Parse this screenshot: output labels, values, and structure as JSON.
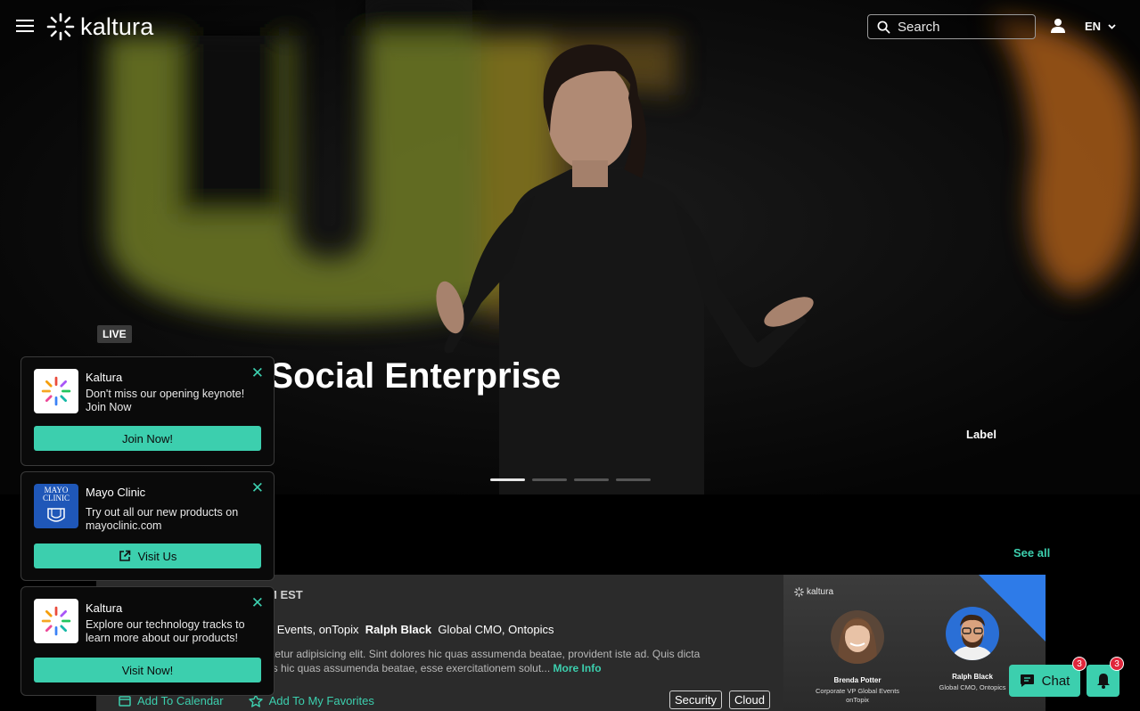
{
  "header": {
    "logo_text": "kaltura",
    "search_placeholder": "Search",
    "language": "EN"
  },
  "hero": {
    "live_badge": "LIVE",
    "title": "f Social Enterprise",
    "label": "Label",
    "slides_total": 4,
    "slide_active": 1
  },
  "session": {
    "see_all": "See all",
    "time": "M EST",
    "speakers_prefix": "al Events, onTopix",
    "speaker2_name": "Ralph Black",
    "speaker2_role": "Global CMO, Ontopics",
    "description_line1": "ctetur adipisicing elit. Sint dolores hic quas assumenda beatae, provident iste ad. Quis dicta",
    "description_line2": "es hic quas assumenda beatae, esse exercitationem solut...",
    "more_info": "More Info",
    "add_to_calendar": "Add To Calendar",
    "add_to_favorites": "Add To My Favorites",
    "tags": [
      "Security",
      "Cloud"
    ],
    "thumbnail": {
      "logo_text": "kaltura",
      "speakers": [
        {
          "name": "Brenda Potter",
          "role": "Corporate VP Global Events onTopix"
        },
        {
          "name": "Ralph Black",
          "role": "Global CMO, Ontopics"
        }
      ]
    }
  },
  "notifications": [
    {
      "brand": "Kaltura",
      "message": "Don't miss our opening keynote! Join Now",
      "cta": "Join Now!"
    },
    {
      "brand": "Mayo Clinic",
      "message": "Try out all our new products on mayoclinic.com",
      "cta": "Visit Us",
      "logo_text": "MAYO CLINIC"
    },
    {
      "brand": "Kaltura",
      "message": "Explore our technology tracks to learn more about our products!",
      "cta": "Visit Now!"
    }
  ],
  "floating": {
    "chat_label": "Chat",
    "chat_badge": "3",
    "bell_badge": "3"
  },
  "colors": {
    "accent": "#3ccfae",
    "badge": "#e0263b"
  }
}
